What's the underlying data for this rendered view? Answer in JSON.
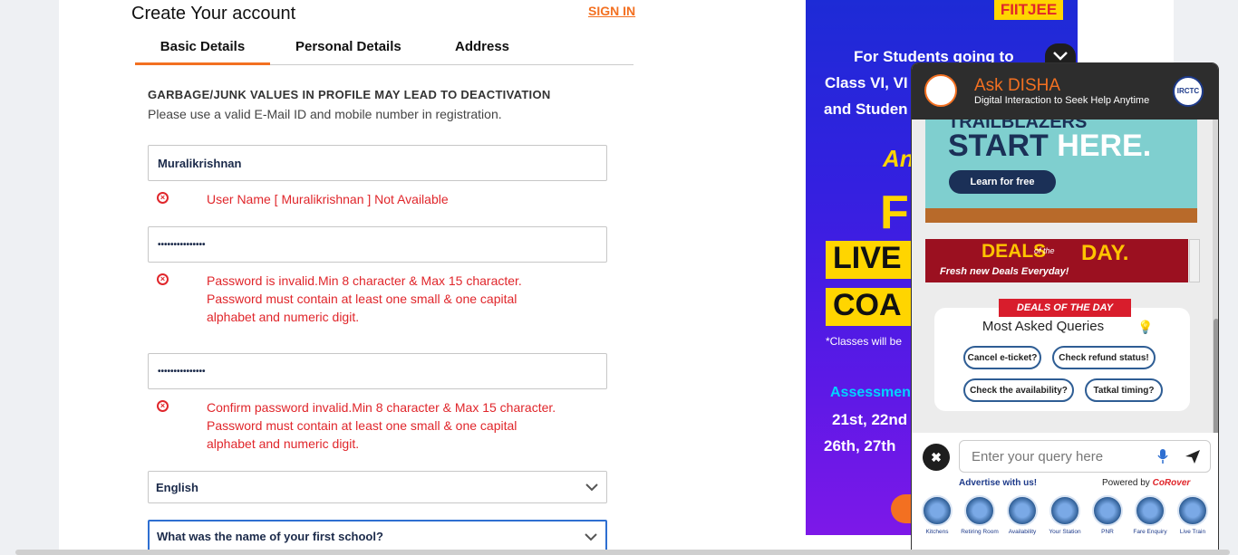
{
  "form": {
    "title": "Create Your account",
    "signin": "SIGN IN",
    "tabs": [
      "Basic Details",
      "Personal Details",
      "Address"
    ],
    "warning": "GARBAGE/JUNK VALUES IN PROFILE MAY LEAD TO DEACTIVATION",
    "note": "Please use a valid E-Mail ID and mobile number in registration.",
    "username": "Muralikrishnan",
    "username_error": "User Name [ Muralikrishnan ] Not Available",
    "password_mask": "•••••••••••••••",
    "password_error": [
      "Password is invalid.Min 8 character & Max 15 character.",
      "Password must contain at least one small & one capital",
      "alphabet and numeric digit."
    ],
    "confirm_mask": "•••••••••••••••",
    "confirm_error": [
      "Confirm password invalid.Min 8 character & Max 15 character.",
      "Password must contain at least one small & one capital",
      "alphabet and numeric digit."
    ],
    "language": "English",
    "security_question": "What was the name of your first school?"
  },
  "ad": {
    "logo": "FIITJEE",
    "line1": "For Students going to",
    "line2": "Class VI, VI",
    "line3": "and Studen",
    "an": "An",
    "f": "F",
    "live": "LIVE",
    "coa": "COA",
    "classes": "*Classes will be",
    "assessment": "Assessmen",
    "dates1": "21st, 22nd",
    "dates2": "26th, 27th"
  },
  "disha": {
    "title": "Ask DISHA",
    "subtitle": "Digital Interaction to Seek Help Anytime",
    "irctc": "IRCTC",
    "banner1_top": "TRAILBLAZERS",
    "banner1_start": "START",
    "banner1_here": "HERE.",
    "banner1_button": "Learn for free",
    "banner2_deals": "DEALS",
    "banner2_of": "of the",
    "banner2_day": "DAY.",
    "banner2_fresh": "Fresh new Deals Everyday!",
    "ribbon": "DEALS OF THE DAY",
    "queries_title": "Most Asked Queries",
    "chips": [
      "Cancel e-ticket?",
      "Check refund status!",
      "Check the availability?",
      "Tatkal timing?"
    ],
    "input_placeholder": "Enter your query here",
    "advertise": "Advertise with us!",
    "powered": "Powered by",
    "powered_brand": "CoRover",
    "icons": [
      "Kitchens",
      "Retiring Room",
      "Availability",
      "Your Station",
      "PNR",
      "Fare Enquiry",
      "Live Train"
    ]
  }
}
